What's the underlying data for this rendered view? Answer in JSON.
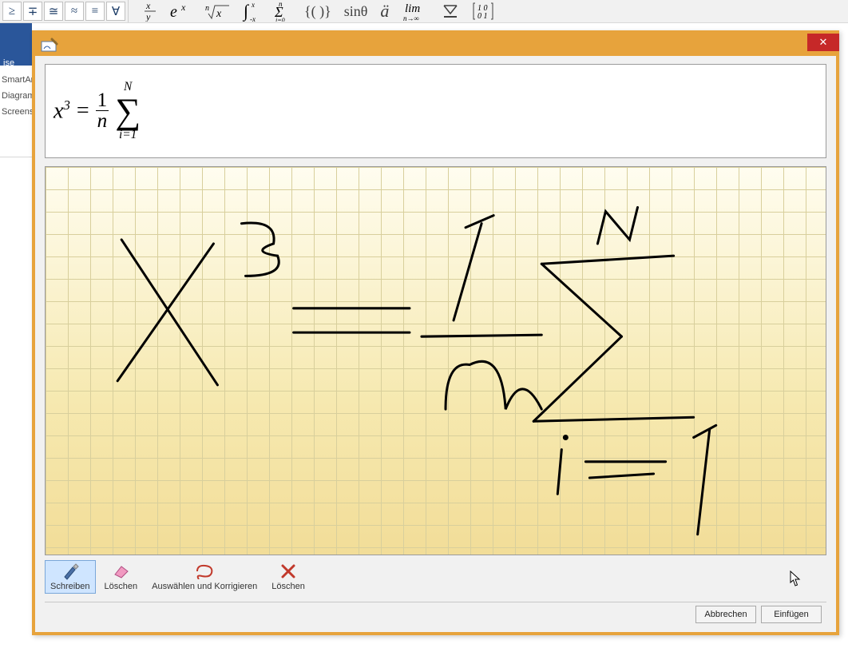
{
  "ribbon_symbols": [
    "≥",
    "∓",
    "≅",
    "≈",
    "≡",
    "∀"
  ],
  "ribbon_structures": {
    "fraction": "x/y",
    "exponent": "eˣ",
    "radical": "ⁿ√x",
    "integral": "∫",
    "summation": "Σ",
    "bracket": "{()}",
    "function": "sinθ",
    "accent": "ä",
    "limit": "lim",
    "operator": "≜",
    "matrix": "[10;01]"
  },
  "blue_strip_label": "ise",
  "left_menu_items": [
    "SmartArt",
    "Diagram",
    "Screensh"
  ],
  "dialog": {
    "preview_formula": {
      "lhs_base": "x",
      "lhs_exp": "3",
      "equals": "=",
      "frac_num": "1",
      "frac_den": "n",
      "sum_sign": "∑",
      "sum_upper": "N",
      "sum_lower": "i=1"
    },
    "tools": {
      "write": "Schreiben",
      "erase": "Löschen",
      "select": "Auswählen und Korrigieren",
      "clear": "Löschen"
    },
    "cancel": "Abbrechen",
    "insert": "Einfügen"
  }
}
